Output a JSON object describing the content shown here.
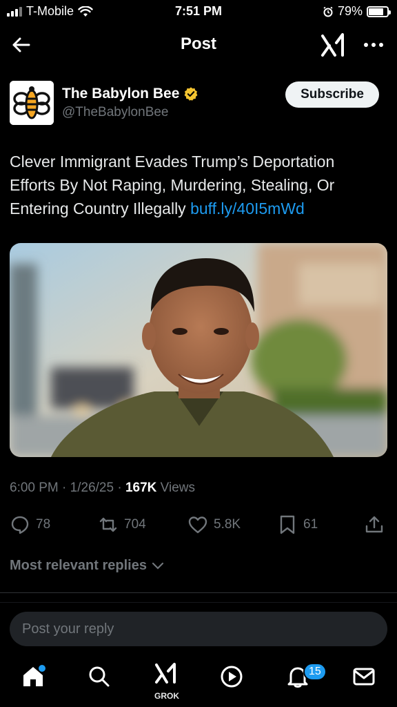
{
  "status_bar": {
    "carrier": "T-Mobile",
    "time": "7:51 PM",
    "battery": "79%",
    "battery_level": 0.79
  },
  "header": {
    "title": "Post",
    "back_icon": "arrow-left-icon",
    "grok_icon": "grok-icon",
    "more_icon": "more-icon"
  },
  "author": {
    "name": "The Babylon Bee",
    "handle": "@TheBabylonBee",
    "verified": true,
    "verified_color": "#f4c430",
    "subscribe_label": "Subscribe"
  },
  "tweet": {
    "text": "Clever Immigrant Evades Trump’s Deportation Efforts By Not Raping, Murdering, Stealing, Or Entering Country Illegally ",
    "link": "buff.ly/40I5mWd",
    "link_color": "#1d9bf0"
  },
  "meta": {
    "time": "6:00 PM",
    "date": "1/26/25",
    "views_count": "167K",
    "views_label": "Views"
  },
  "actions": {
    "replies": "78",
    "reposts": "704",
    "likes": "5.8K",
    "bookmarks": "61"
  },
  "replies_sort": "Most relevant replies",
  "reply_placeholder": "Post your reply",
  "tabbar": {
    "grok_label": "GROK",
    "notifications_badge": "15",
    "accent": "#1d9bf0"
  }
}
